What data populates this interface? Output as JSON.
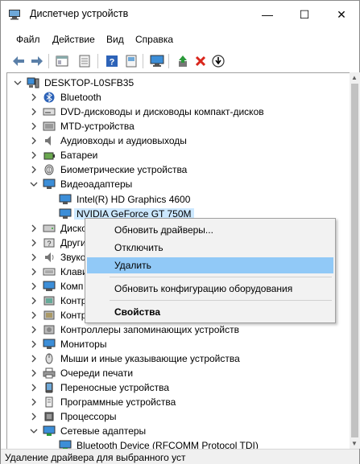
{
  "window": {
    "title": "Диспетчер устройств",
    "min_glyph": "—",
    "max_glyph": "☐",
    "close_glyph": "✕"
  },
  "menu": [
    "Файл",
    "Действие",
    "Вид",
    "Справка"
  ],
  "toolbar": [
    "back-icon",
    "forward-icon",
    "show-hide-icon",
    "properties-icon",
    "help-icon",
    "device-view-icon",
    "monitor-icon",
    "update-driver-icon",
    "uninstall-icon",
    "download-icon"
  ],
  "tree": {
    "root": "DESKTOP-L0SFB35",
    "items": [
      {
        "label": "Bluetooth",
        "icon": "bluetooth-icon"
      },
      {
        "label": "DVD-дисководы и дисководы компакт-дисков",
        "icon": "dvd-icon"
      },
      {
        "label": "MTD-устройства",
        "icon": "mtd-icon"
      },
      {
        "label": "Аудиовходы и аудиовыходы",
        "icon": "audio-icon"
      },
      {
        "label": "Батареи",
        "icon": "battery-icon"
      },
      {
        "label": "Биометрические устройства",
        "icon": "fingerprint-icon"
      },
      {
        "label": "Видеоадаптеры",
        "icon": "display-adapter-icon"
      },
      {
        "label": "Intel(R) HD Graphics 4600",
        "icon": "display-adapter-icon"
      },
      {
        "label": "NVIDIA GeForce GT 750M",
        "icon": "display-adapter-icon"
      },
      {
        "label": "Диско",
        "icon": "disk-icon"
      },
      {
        "label": "Други",
        "icon": "other-icon"
      },
      {
        "label": "Звуко",
        "icon": "sound-icon"
      },
      {
        "label": "Клави",
        "icon": "keyboard-icon"
      },
      {
        "label": "Комп",
        "icon": "computer-icon"
      },
      {
        "label": "Контр",
        "icon": "controller-icon"
      },
      {
        "label": "Контр",
        "icon": "controller-icon"
      },
      {
        "label": "Контроллеры запоминающих устройств",
        "icon": "storage-icon"
      },
      {
        "label": "Мониторы",
        "icon": "monitor-icon"
      },
      {
        "label": "Мыши и иные указывающие устройства",
        "icon": "mouse-icon"
      },
      {
        "label": "Очереди печати",
        "icon": "printer-icon"
      },
      {
        "label": "Переносные устройства",
        "icon": "portable-icon"
      },
      {
        "label": "Программные устройства",
        "icon": "software-icon"
      },
      {
        "label": "Процессоры",
        "icon": "cpu-icon"
      },
      {
        "label": "Сетевые адаптеры",
        "icon": "network-icon"
      },
      {
        "label": "Bluetooth Device (RFCOMM Protocol TDI)",
        "icon": "network-icon"
      }
    ]
  },
  "context_menu": {
    "items": [
      "Обновить драйверы...",
      "Отключить",
      "Удалить",
      "Обновить конфигурацию оборудования",
      "Свойства"
    ]
  },
  "status": "Удаление драйвера для выбранного уст",
  "colors": {
    "selection": "#cce8ff",
    "menu_hover": "#91c9f7",
    "monitor_blue": "#3c8ed8"
  }
}
